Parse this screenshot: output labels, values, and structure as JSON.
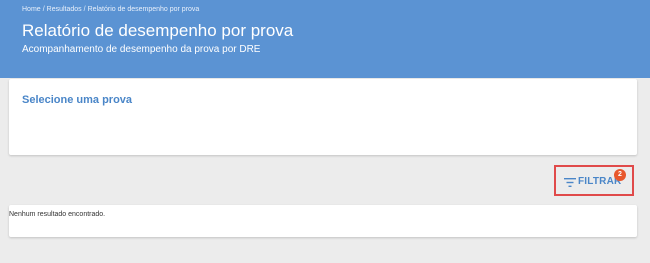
{
  "breadcrumb": {
    "items": [
      "Home",
      "Resultados",
      "Relatório de desempenho por prova"
    ],
    "separator": "/"
  },
  "header": {
    "title": "Relatório de desempenho por prova",
    "subtitle": "Acompanhamento de desempenho da prova por DRE",
    "background_color": "#5b93d3"
  },
  "select_card": {
    "title": "Selecione uma prova"
  },
  "filter": {
    "label": "FILTRAR",
    "badge_count": "2",
    "icon": "filter-list-icon",
    "accent_color": "#4a86c8",
    "badge_color": "#e8572c"
  },
  "results": {
    "empty_message": "Nenhum resultado encontrado."
  }
}
